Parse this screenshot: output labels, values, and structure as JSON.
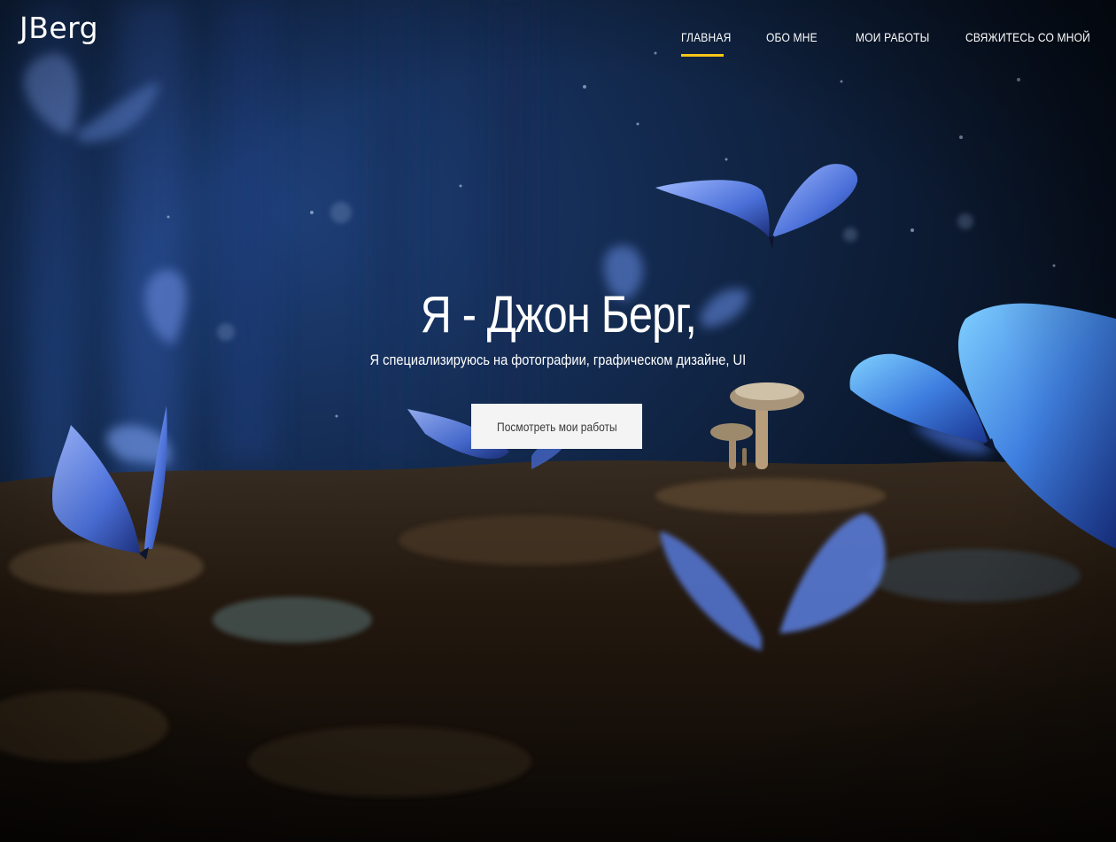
{
  "brand": {
    "logo_text": "JBerg"
  },
  "nav": {
    "items": [
      {
        "label": "ГЛАВНАЯ",
        "active": true
      },
      {
        "label": "ОБО МНЕ",
        "active": false
      },
      {
        "label": "МОИ РАБОТЫ",
        "active": false
      },
      {
        "label": "СВЯЖИТЕСЬ СО МНОЙ",
        "active": false
      }
    ]
  },
  "hero": {
    "title": "Я - Джон Берг,",
    "subtitle": "Я специализируюсь на фотографии, графическом дизайне, UI",
    "cta_label": "Посмотреть мои работы"
  },
  "colors": {
    "accent": "#f5c518",
    "text": "#ffffff",
    "button_bg": "#f4f4f4",
    "button_text": "#3a3a3a"
  },
  "icons": {
    "hero_image": "forest-butterflies-image"
  }
}
